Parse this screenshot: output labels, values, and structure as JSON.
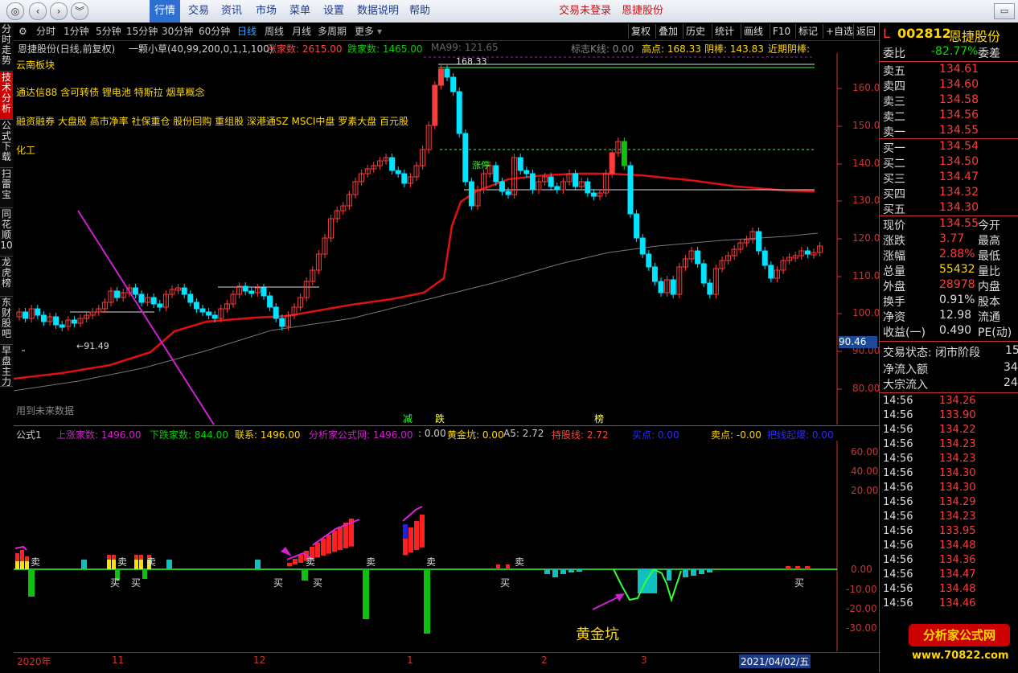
{
  "topbar": {
    "menus": [
      "行情",
      "交易",
      "资讯",
      "市场",
      "菜单",
      "设置",
      "数据说明",
      "帮助"
    ],
    "login": "交易未登录",
    "stock_name": "恩捷股份"
  },
  "sidebar_tabs": [
    "分时走势",
    "技术分析",
    "公式下载",
    "扫雷宝",
    "同花顺10",
    "龙虎榜",
    "东财股吧",
    "早盘主力"
  ],
  "periods": [
    "分时",
    "1分钟",
    "5分钟",
    "15分钟",
    "30分钟",
    "60分钟",
    "日线",
    "周线",
    "月线",
    "多周期",
    "更多"
  ],
  "active_period": "日线",
  "tools": [
    "复权",
    "叠加",
    "历史",
    "统计",
    "画线",
    "F10",
    "标记",
    "+自选",
    "返回"
  ],
  "main_chart": {
    "title": "恩捷股份(日线,前复权)",
    "indicator": "一颗小草(40,99,200,0,1,1,100)",
    "up_count": "涨家数: 2615.00",
    "down_count": "跌家数: 1465.00",
    "ma": "MA99: 121.65",
    "ksign": "标志K线: 0.00",
    "high": "高点: 168.33",
    "yinbang": "阴棒: 143.83",
    "recent": "近期阴棒:",
    "concepts": [
      "云南板块",
      "通达信88 含可转债 锂电池 特斯拉 烟草概念",
      "融资融券 大盘股 高市净率 社保重仓 股份回购 重组股 深港通SZ MSCI中盘 罗素大盘 百元股",
      "化工"
    ],
    "high_label": "168.33",
    "low_label": "←91.49",
    "future_text": "用到未来数据",
    "axis_labels": [
      "160.0",
      "150.0",
      "140.0",
      "130.0",
      "120.0",
      "110.0",
      "100.0",
      "90.00",
      "80.00"
    ],
    "price_tag": "90.46",
    "sig_jian": "减",
    "sig_die": "跌",
    "sig_bang": "榜",
    "sig_zhang": "涨停"
  },
  "sub_chart": {
    "name": "公式1",
    "up": "上涨家数: 1496.00",
    "down": "下跌家数: 844.00",
    "lianxi": "联系: 1496.00",
    "fxj": "分析家公式网: 1496.00",
    "zero": ": 0.00",
    "gold": "黄金坑: 0.00",
    "a5": "A5: 2.72",
    "hold": "持股线: 2.72",
    "buy": "买点: 0.00",
    "sell": "卖点: -0.00",
    "bottom": "把线起爆: 0.00",
    "axis_labels": [
      "60.00",
      "40.00",
      "20.00",
      "0.00",
      "-10.00",
      "-20.00",
      "-30.00"
    ],
    "annotation": "黄金坑",
    "mai": "卖",
    "buy_word": "买"
  },
  "dates": [
    "2020年",
    "11",
    "12",
    "1",
    "2",
    "3",
    "2021/04/02/五"
  ],
  "quote": {
    "code": "002812",
    "name": "恩捷股份",
    "weibi_label": "委比",
    "weibi": "-82.77%",
    "weicha": "委差",
    "asks": [
      [
        "卖五",
        "134.61"
      ],
      [
        "卖四",
        "134.60"
      ],
      [
        "卖三",
        "134.58"
      ],
      [
        "卖二",
        "134.56"
      ],
      [
        "卖一",
        "134.55"
      ]
    ],
    "bids": [
      [
        "买一",
        "134.54"
      ],
      [
        "买二",
        "134.50"
      ],
      [
        "买三",
        "134.47"
      ],
      [
        "买四",
        "134.32"
      ],
      [
        "买五",
        "134.30"
      ]
    ],
    "stats": [
      [
        "现价",
        "134.55",
        "今开"
      ],
      [
        "涨跌",
        "3.77",
        "最高"
      ],
      [
        "涨幅",
        "2.88%",
        "最低"
      ],
      [
        "总量",
        "55432",
        "量比"
      ],
      [
        "外盘",
        "28978",
        "内盘"
      ],
      [
        "换手",
        "0.91%",
        "股本"
      ],
      [
        "净资",
        "12.98",
        "流通"
      ],
      [
        "收益(一)",
        "0.490",
        "PE(动)"
      ]
    ],
    "trade_status": "交易状态: 闭市阶段",
    "trade_status_val": "15:",
    "netflow": "净流入额",
    "netflow_val": "34",
    "bigflow": "大宗流入",
    "bigflow_val": "24",
    "ticks": [
      [
        "14:56",
        "134.26"
      ],
      [
        "14:56",
        "133.90"
      ],
      [
        "14:56",
        "134.22"
      ],
      [
        "14:56",
        "134.23"
      ],
      [
        "14:56",
        "134.23"
      ],
      [
        "14:56",
        "134.30"
      ],
      [
        "14:56",
        "134.30"
      ],
      [
        "14:56",
        "134.29"
      ],
      [
        "14:56",
        "134.23"
      ],
      [
        "14:56",
        "133.95"
      ],
      [
        "14:56",
        "134.48"
      ],
      [
        "14:56",
        "134.36"
      ],
      [
        "14:56",
        "134.47"
      ],
      [
        "14:56",
        "134.48"
      ],
      [
        "14:56",
        "134.46"
      ]
    ],
    "watermark": "分析家公式网",
    "watermark_url": "www.70822.com"
  }
}
